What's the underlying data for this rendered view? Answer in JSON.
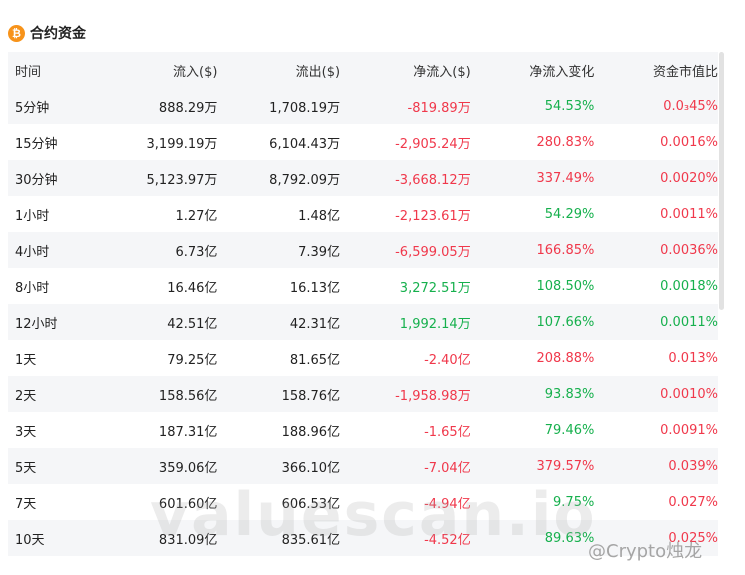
{
  "header": {
    "icon": "bitcoin-icon",
    "icon_glyph": "₿",
    "title": "合约资金"
  },
  "table": {
    "columns": [
      "时间",
      "流入($)",
      "流出($)",
      "净流入($)",
      "净流入变化",
      "资金市值比"
    ],
    "rows": [
      {
        "time": "5分钟",
        "inflow": "888.29万",
        "outflow": "1,708.19万",
        "net": "-819.89万",
        "change": "54.53%",
        "ratio": "0.0₃45%"
      },
      {
        "time": "15分钟",
        "inflow": "3,199.19万",
        "outflow": "6,104.43万",
        "net": "-2,905.24万",
        "change": "280.83%",
        "ratio": "0.0016%"
      },
      {
        "time": "30分钟",
        "inflow": "5,123.97万",
        "outflow": "8,792.09万",
        "net": "-3,668.12万",
        "change": "337.49%",
        "ratio": "0.0020%"
      },
      {
        "time": "1小时",
        "inflow": "1.27亿",
        "outflow": "1.48亿",
        "net": "-2,123.61万",
        "change": "54.29%",
        "ratio": "0.0011%"
      },
      {
        "time": "4小时",
        "inflow": "6.73亿",
        "outflow": "7.39亿",
        "net": "-6,599.05万",
        "change": "166.85%",
        "ratio": "0.0036%"
      },
      {
        "time": "8小时",
        "inflow": "16.46亿",
        "outflow": "16.13亿",
        "net": "3,272.51万",
        "change": "108.50%",
        "ratio": "0.0018%"
      },
      {
        "time": "12小时",
        "inflow": "42.51亿",
        "outflow": "42.31亿",
        "net": "1,992.14万",
        "change": "107.66%",
        "ratio": "0.0011%"
      },
      {
        "time": "1天",
        "inflow": "79.25亿",
        "outflow": "81.65亿",
        "net": "-2.40亿",
        "change": "208.88%",
        "ratio": "0.013%"
      },
      {
        "time": "2天",
        "inflow": "158.56亿",
        "outflow": "158.76亿",
        "net": "-1,958.98万",
        "change": "93.83%",
        "ratio": "0.0010%"
      },
      {
        "time": "3天",
        "inflow": "187.31亿",
        "outflow": "188.96亿",
        "net": "-1.65亿",
        "change": "79.46%",
        "ratio": "0.0091%"
      },
      {
        "time": "5天",
        "inflow": "359.06亿",
        "outflow": "366.10亿",
        "net": "-7.04亿",
        "change": "379.57%",
        "ratio": "0.039%"
      },
      {
        "time": "7天",
        "inflow": "601.60亿",
        "outflow": "606.53亿",
        "net": "-4.94亿",
        "change": "9.75%",
        "ratio": "0.027%"
      },
      {
        "time": "10天",
        "inflow": "831.09亿",
        "outflow": "835.61亿",
        "net": "-4.52亿",
        "change": "89.63%",
        "ratio": "0.025%"
      }
    ]
  },
  "colors": {
    "negative": "#f0384b",
    "positive": "#16b04d",
    "brand": "#f7931a"
  },
  "watermark": "valuescan.io",
  "credit": "@Crypto烛龙"
}
